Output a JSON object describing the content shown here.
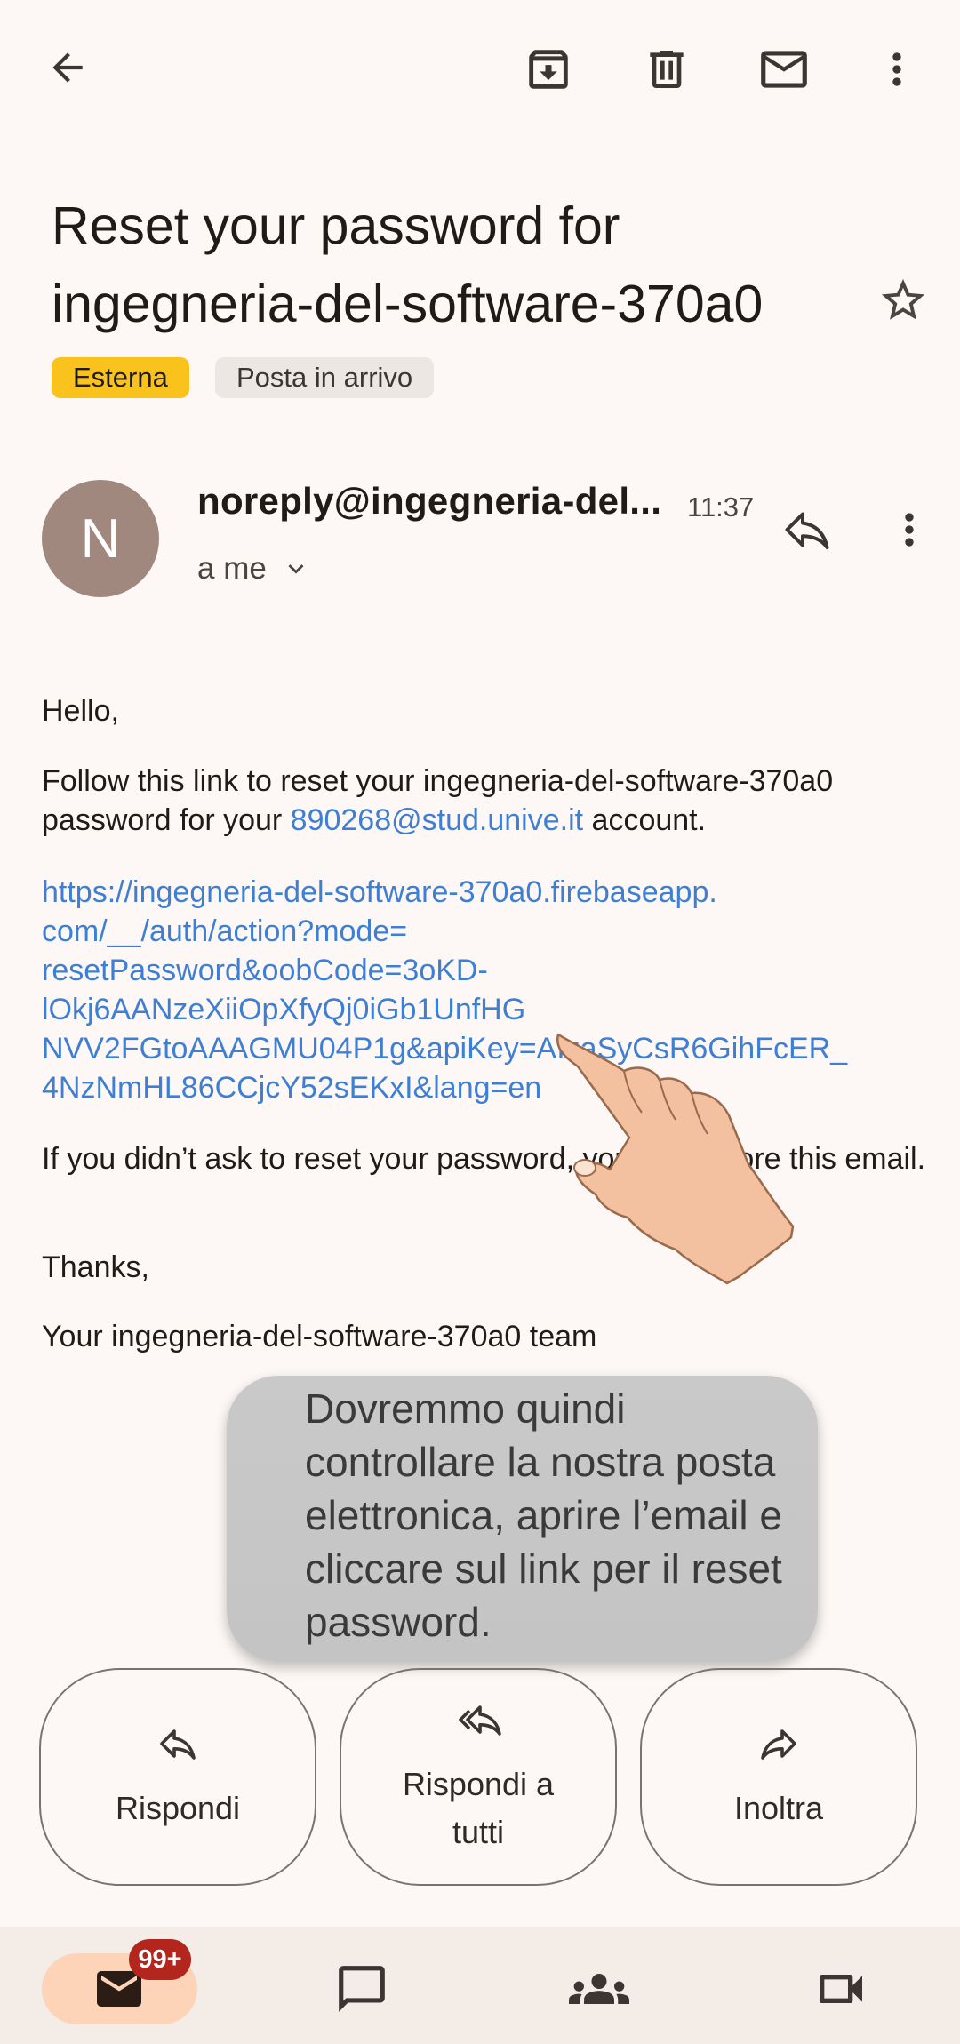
{
  "toolbar": {
    "back_icon": "arrow-back-icon",
    "archive_icon": "archive-icon",
    "delete_icon": "trash-icon",
    "mark_unread_icon": "mail-icon",
    "more_icon": "more-vert-icon"
  },
  "email": {
    "subject": "Reset your password for ingegneria-del-software-370a0",
    "labels": [
      "Esterna",
      "Posta in arrivo"
    ],
    "sender_initial": "N",
    "sender": "noreply@ingegneria-del...",
    "time": "11:37",
    "recipient": "a me",
    "body": {
      "greeting": "Hello,",
      "line1_a": "Follow this link to reset your ingegneria-del-software-370a0 password for your ",
      "line1_email": "890268@stud.unive.it",
      "line1_b": " account.",
      "reset_link": "https://ingegneria-del-software-370a0.firebaseapp.com/__/auth/action?mode=resetPassword&oobCode=3oKD-lOkj6AANzeXiiOpXfyQj0iGb1UnfHGNVV2FGtoAAAGMU04P1g&apiKey=AIzaSyCsR6GihFcER_4NzNmHL86CCjcY52sEKxI&lang=en",
      "link_lines": [
        "https://ingegneria-del-software-370a0.firebaseapp.",
        "com/__/auth/action?mode=",
        "resetPassword&oobCode=3oKD-",
        "lOkj6AANzeXiiOpXfyQj0iGb1UnfHG",
        "NVV2FGtoAAAGMU04P1g&apiKey=AIzaSyCsR6GihFcER_",
        "4NzNmHL86CCjcY52sEKxI&lang=en"
      ],
      "ignore_text": "If you didn’t ask to reset your password, you can ignore this email.",
      "thanks": "Thanks,",
      "signature": "Your ingegneria-del-software-370a0 team"
    }
  },
  "tutorial_overlay": {
    "text": "Dovremmo quindi controllare la nostra posta elettronica, aprire l’email e cliccare sul link per il reset password.",
    "pointer_icon": "hand-pointer-icon"
  },
  "actions": {
    "reply": "Rispondi",
    "reply_all": "Rispondi a tutti",
    "forward": "Inoltra"
  },
  "bottom_nav": {
    "mail_badge": "99+",
    "items": [
      "mail-icon",
      "chat-icon",
      "spaces-icon",
      "meet-icon"
    ]
  },
  "colors": {
    "background": "#fdf8f5",
    "label_external": "#f9c21d",
    "link": "#3f7fd3",
    "badge": "#b3261e",
    "nav_active": "#fdd4b8"
  }
}
